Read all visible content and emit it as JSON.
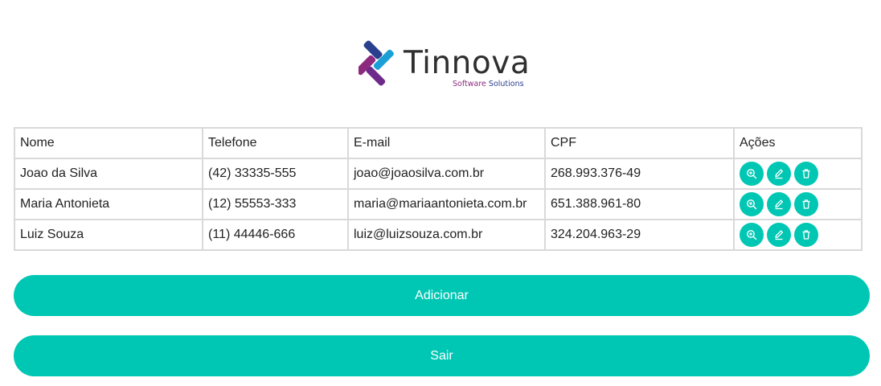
{
  "brand": {
    "name": "Tinnova",
    "tagline_a": "Software",
    "tagline_b": "Solutions",
    "colors": {
      "magenta": "#8e2a7e",
      "blue": "#2b3f8f",
      "cyan": "#1aa0d6",
      "teal": "#00c7b3"
    }
  },
  "table": {
    "headers": [
      "Nome",
      "Telefone",
      "E-mail",
      "CPF",
      "Ações"
    ],
    "rows": [
      {
        "name": "Joao da Silva",
        "phone": "(42) 33335-555",
        "email": "joao@joaosilva.com.br",
        "cpf": "268.993.376-49"
      },
      {
        "name": "Maria Antonieta",
        "phone": "(12) 55553-333",
        "email": "maria@mariaantonieta.com.br",
        "cpf": "651.388.961-80"
      },
      {
        "name": "Luiz Souza",
        "phone": "(11) 44446-666",
        "email": "luiz@luizsouza.com.br",
        "cpf": "324.204.963-29"
      }
    ],
    "row_actions": [
      "zoom-in-icon",
      "pencil-icon",
      "trash-icon"
    ]
  },
  "buttons": {
    "add": "Adicionar",
    "exit": "Sair"
  }
}
